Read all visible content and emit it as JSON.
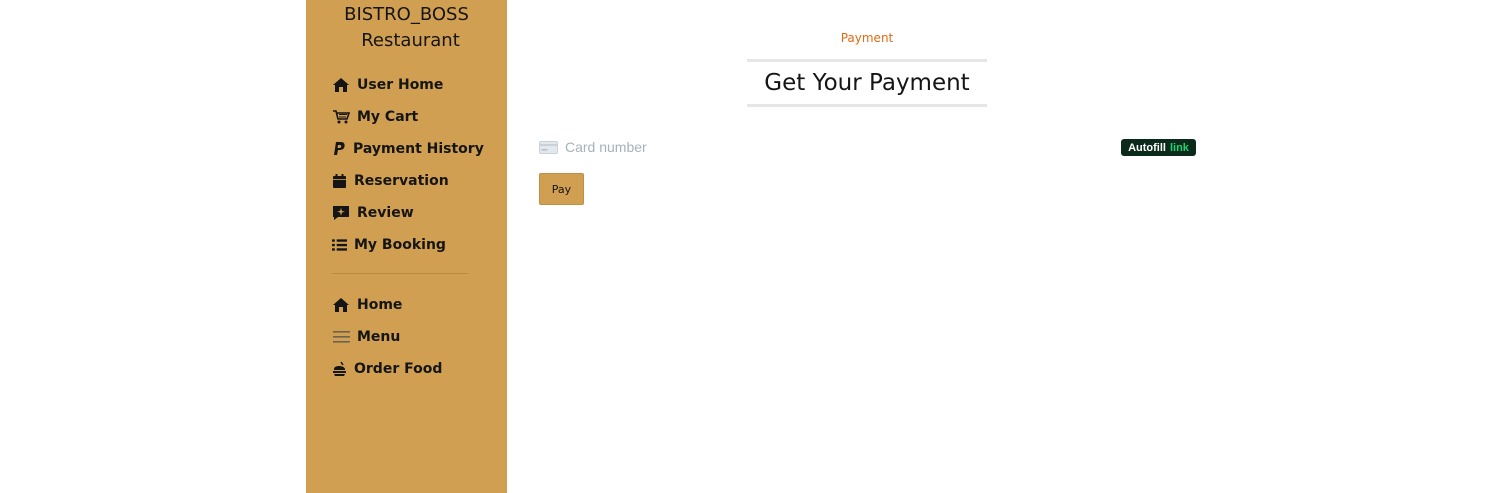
{
  "brand": {
    "line1": "BISTRO_BOSS",
    "line2": "Restaurant"
  },
  "sidebar": {
    "user_items": [
      {
        "label": "User Home",
        "icon": "home-icon"
      },
      {
        "label": "My Cart",
        "icon": "cart-icon"
      },
      {
        "label": "Payment History",
        "icon": "paypal-icon"
      },
      {
        "label": "Reservation",
        "icon": "calendar-icon"
      },
      {
        "label": "Review",
        "icon": "review-icon"
      },
      {
        "label": "My Booking",
        "icon": "list-icon"
      }
    ],
    "main_items": [
      {
        "label": "Home",
        "icon": "home-icon"
      },
      {
        "label": "Menu",
        "icon": "menu-icon"
      },
      {
        "label": "Order Food",
        "icon": "food-icon"
      }
    ]
  },
  "page": {
    "subtitle": "Payment",
    "title": "Get Your Payment"
  },
  "payment_form": {
    "card_placeholder": "Card number",
    "card_value": "",
    "autofill_label": "Autofill",
    "autofill_link": "link",
    "pay_label": "Pay"
  },
  "colors": {
    "sidebar_bg": "#d19f51",
    "subtitle": "#e06a12",
    "autofill_bg": "#0b2a1c",
    "autofill_link": "#21d46b"
  }
}
